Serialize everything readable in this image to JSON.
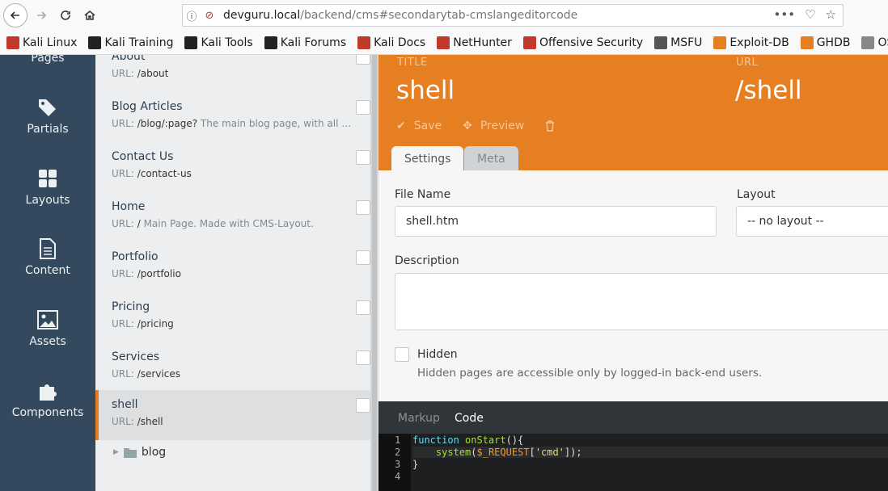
{
  "browser": {
    "url_host": "devguru.local",
    "url_path": "/backend/cms#secondarytab-cmslangeditorcode",
    "bookmarks": [
      {
        "label": "Kali Linux",
        "icon": "kali-icon",
        "color": "#c0392b"
      },
      {
        "label": "Kali Training",
        "icon": "kali-dragon-icon",
        "color": "#222222"
      },
      {
        "label": "Kali Tools",
        "icon": "kali-dragon-icon",
        "color": "#222222"
      },
      {
        "label": "Kali Forums",
        "icon": "kali-dragon-icon",
        "color": "#222222"
      },
      {
        "label": "Kali Docs",
        "icon": "docs-icon",
        "color": "#c0392b"
      },
      {
        "label": "NetHunter",
        "icon": "kali-icon",
        "color": "#c0392b"
      },
      {
        "label": "Offensive Security",
        "icon": "offsec-icon",
        "color": "#c0392b"
      },
      {
        "label": "MSFU",
        "icon": "globe-icon",
        "color": "#555555"
      },
      {
        "label": "Exploit-DB",
        "icon": "exploit-icon",
        "color": "#e67e22"
      },
      {
        "label": "GHDB",
        "icon": "exploit-icon",
        "color": "#e67e22"
      },
      {
        "label": "OSCP",
        "icon": "folder-icon",
        "color": "#888888"
      }
    ]
  },
  "sidebar": {
    "items": [
      {
        "label": "Pages",
        "icon": "pages-icon"
      },
      {
        "label": "Partials",
        "icon": "tag-icon"
      },
      {
        "label": "Layouts",
        "icon": "grid-icon"
      },
      {
        "label": "Content",
        "icon": "file-icon"
      },
      {
        "label": "Assets",
        "icon": "image-icon"
      },
      {
        "label": "Components",
        "icon": "puzzle-icon"
      }
    ]
  },
  "pages": {
    "url_prefix": "URL:",
    "items": [
      {
        "title": "About",
        "url": "/about",
        "desc": ""
      },
      {
        "title": "Blog Articles",
        "url": "/blog/:page?",
        "desc": "The main blog page, with all p..."
      },
      {
        "title": "Contact Us",
        "url": "/contact-us",
        "desc": ""
      },
      {
        "title": "Home",
        "url": "/",
        "desc": "Main Page. Made with CMS-Layout."
      },
      {
        "title": "Portfolio",
        "url": "/portfolio",
        "desc": ""
      },
      {
        "title": "Pricing",
        "url": "/pricing",
        "desc": ""
      },
      {
        "title": "Services",
        "url": "/services",
        "desc": ""
      },
      {
        "title": "shell",
        "url": "/shell",
        "desc": ""
      }
    ],
    "folder": "blog"
  },
  "editor": {
    "title_label": "TITLE",
    "title_value": "shell",
    "url_label": "URL",
    "url_value": "/shell",
    "save_label": "Save",
    "preview_label": "Preview",
    "tabs": [
      "Settings",
      "Meta"
    ],
    "filename_label": "File Name",
    "filename_value": "shell.htm",
    "layout_label": "Layout",
    "layout_value": "-- no layout --",
    "description_label": "Description",
    "description_value": "",
    "hidden_label": "Hidden",
    "hidden_help": "Hidden pages are accessible only by logged-in back-end users.",
    "code_tabs": [
      "Markup",
      "Code"
    ],
    "line_numbers": [
      "1",
      "2",
      "3",
      "4"
    ]
  },
  "colors": {
    "accent": "#e67e22",
    "sidebar": "#34495e"
  }
}
